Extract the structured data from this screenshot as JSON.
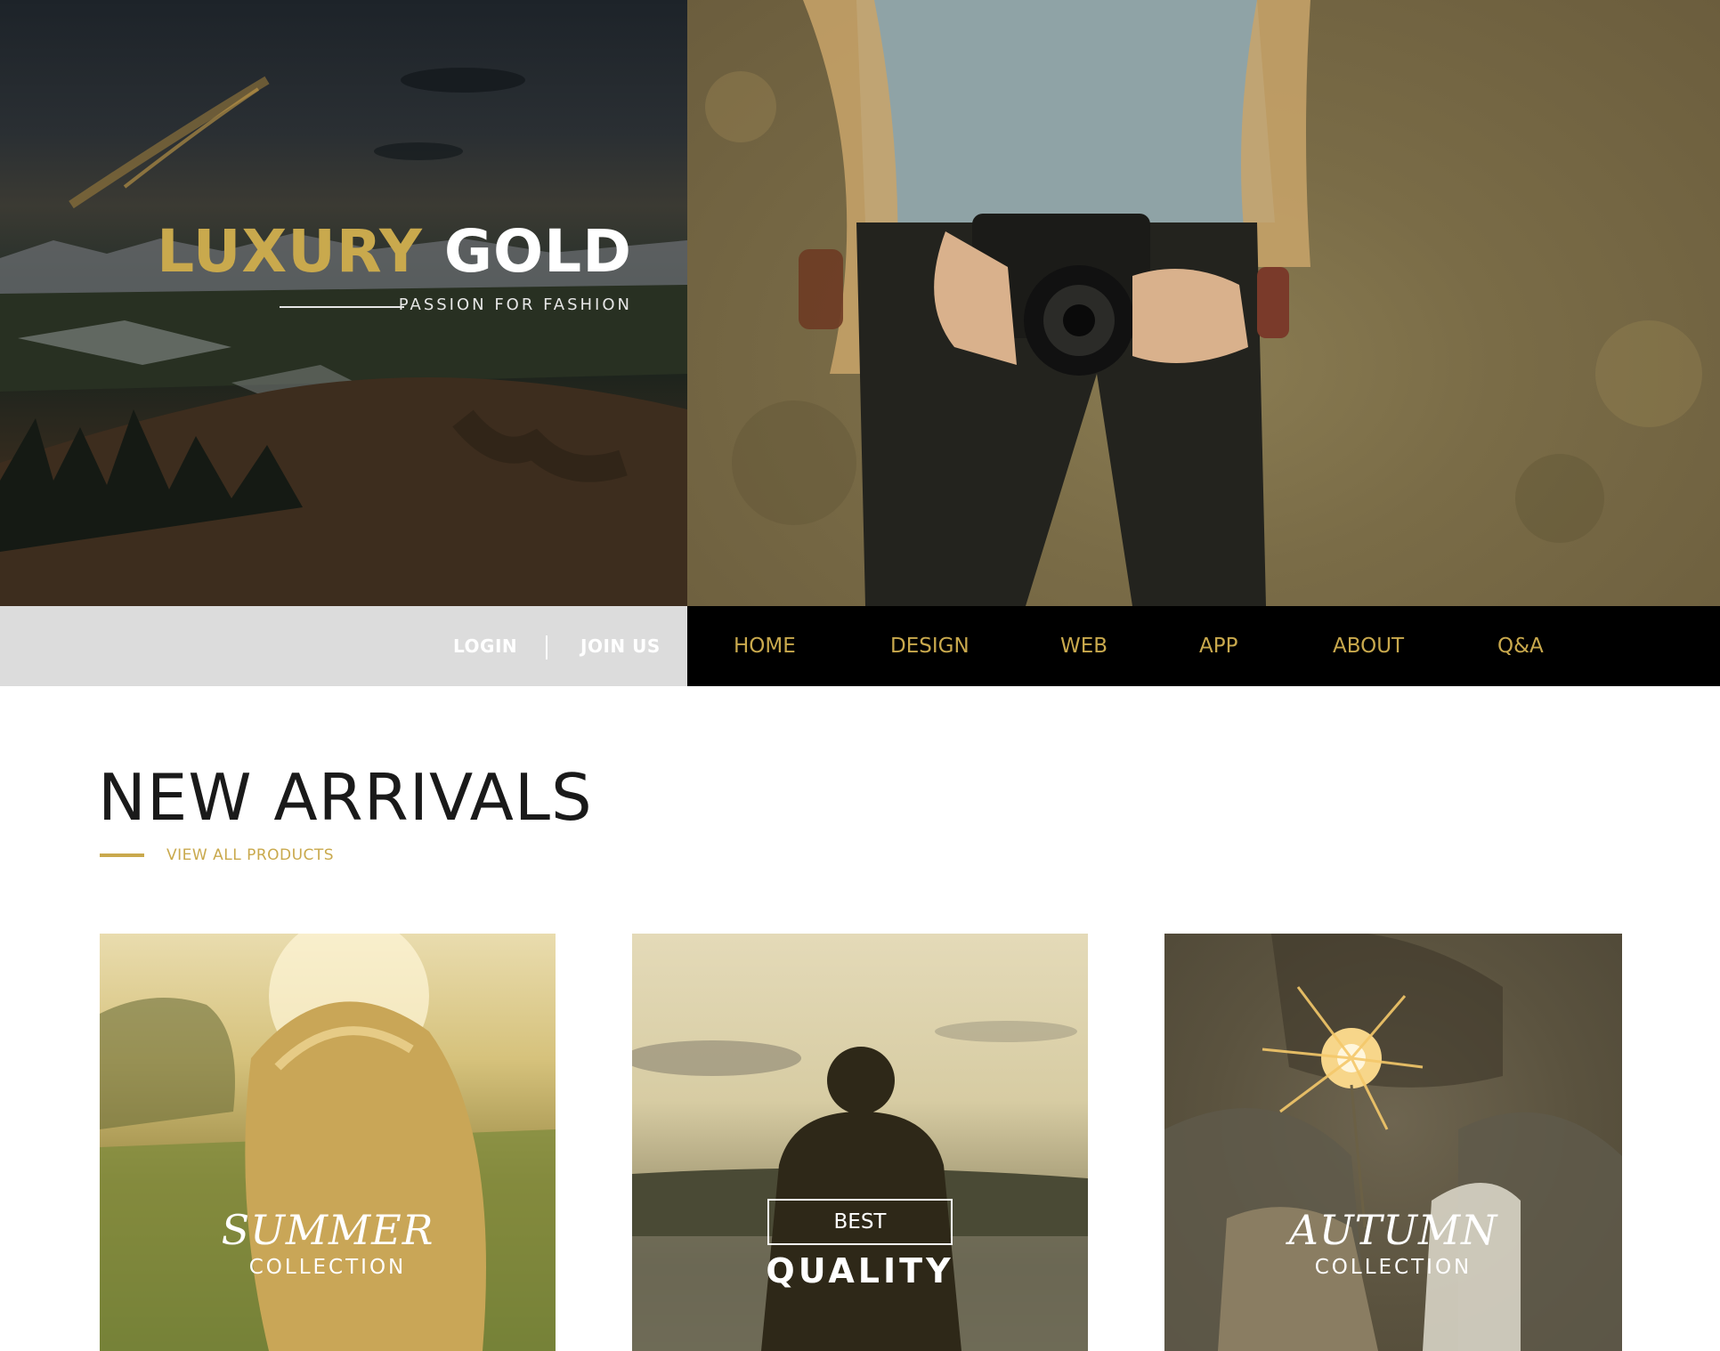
{
  "brand": {
    "title_gold": "LUXURY",
    "title_white": "GOLD",
    "tagline": "PASSION FOR FASHION"
  },
  "account": {
    "login": "LOGIN",
    "join": "JOIN US"
  },
  "nav": {
    "items": [
      "HOME",
      "DESIGN",
      "WEB",
      "APP",
      "ABOUT",
      "Q&A"
    ]
  },
  "arrivals": {
    "title": "NEW ARRIVALS",
    "view_all": "VIEW ALL PRODUCTS",
    "cards": [
      {
        "script": "SUMMER",
        "sub": "COLLECTION"
      },
      {
        "box": "BEST",
        "big": "QUALITY"
      },
      {
        "script": "AUTUMN",
        "sub": "COLLECTION"
      }
    ]
  },
  "colors": {
    "gold": "#c9a94d",
    "nav_dark": "#000000",
    "nav_light": "#dcdcdc",
    "text_dark": "#1a1a1a"
  }
}
